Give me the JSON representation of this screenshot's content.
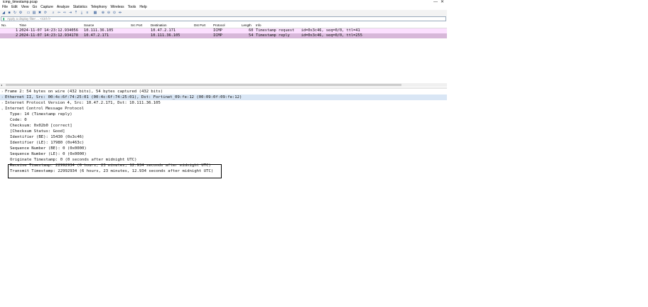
{
  "window": {
    "title": "icmp_timestamp.pcap",
    "minimize": "—",
    "maximize": "☐",
    "close": "✕"
  },
  "menu": [
    "File",
    "Edit",
    "View",
    "Go",
    "Capture",
    "Analyze",
    "Statistics",
    "Telephony",
    "Wireless",
    "Tools",
    "Help"
  ],
  "filter": {
    "placeholder": "Apply a display filter ... <Ctrl-/>"
  },
  "columns": {
    "no": "No.",
    "time": "Time",
    "source": "Source",
    "src_port": "Src Port",
    "destination": "Destination",
    "dst_port": "Dst Port",
    "protocol": "Protocol",
    "length": "Length",
    "info": "Info"
  },
  "packets": [
    {
      "no": "1",
      "time": "2024-11-07 14:23:12.934056",
      "source": "10.111.36.105",
      "destination": "10.47.2.171",
      "protocol": "ICMP",
      "length": "60",
      "info": "Timestamp request   id=0x3c46, seq=0/0, ttl=41"
    },
    {
      "no": "2",
      "time": "2024-11-07 14:23:12.934178",
      "source": "10.47.2.171",
      "destination": "10.111.36.105",
      "protocol": "ICMP",
      "length": "54",
      "info": "Timestamp reply     id=0x3c46, seq=0/0, ttl=255"
    }
  ],
  "details": [
    {
      "text": "Frame 2: 54 bytes on wire (432 bits), 54 bytes captured (432 bits)",
      "arrow": "›"
    },
    {
      "text": "Ethernet II, Src: 00:4c:6f:74:25:01 (00:4c:6f:74:25:01), Dst: Fortinet_09:fe:12 (00:09:0f:09:fe:12)",
      "arrow": "›"
    },
    {
      "text": "Internet Protocol Version 4, Src: 10.47.2.171, Dst: 10.111.36.105",
      "arrow": "›"
    },
    {
      "text": "Internet Control Message Protocol",
      "arrow": "⌄"
    },
    {
      "text": "Type: 14 (Timestamp reply)",
      "arrow": ""
    },
    {
      "text": "Code: 0",
      "arrow": ""
    },
    {
      "text": "Checksum: 0x02b0 [correct]",
      "arrow": ""
    },
    {
      "text": "[Checksum Status: Good]",
      "arrow": ""
    },
    {
      "text": "Identifier (BE): 15430 (0x3c46)",
      "arrow": ""
    },
    {
      "text": "Identifier (LE): 17980 (0x463c)",
      "arrow": ""
    },
    {
      "text": "Sequence Number (BE): 0 (0x0000)",
      "arrow": ""
    },
    {
      "text": "Sequence Number (LE): 0 (0x0000)",
      "arrow": ""
    },
    {
      "text": "Originate Timestamp: 0 (0 seconds after midnight UTC)",
      "arrow": ""
    },
    {
      "text": "Receive Timestamp: 22992934 (6 hours, 23 minutes, 12.934 seconds after midnight UTC)",
      "arrow": ""
    },
    {
      "text": "Transmit Timestamp: 22992934 (6 hours, 23 minutes, 12.934 seconds after midnight UTC)",
      "arrow": ""
    }
  ],
  "toolbar_icons": [
    "shark-fin-start-icon",
    "stop-icon",
    "restart-icon",
    "options-gear-icon",
    "open-folder-icon",
    "save-icon",
    "close-file-icon",
    "reload-icon",
    "find-icon",
    "back-icon",
    "forward-icon",
    "go-to-packet-icon",
    "first-packet-icon",
    "last-packet-icon",
    "autoscroll-icon",
    "colorize-icon",
    "zoom-in-icon",
    "zoom-out-icon",
    "zoom-reset-icon",
    "resize-columns-icon"
  ],
  "colors": {
    "row_request": "#fce0ff",
    "row_reply_selected": "#d7b7d9",
    "detail_selected": "#d9e6f5"
  }
}
